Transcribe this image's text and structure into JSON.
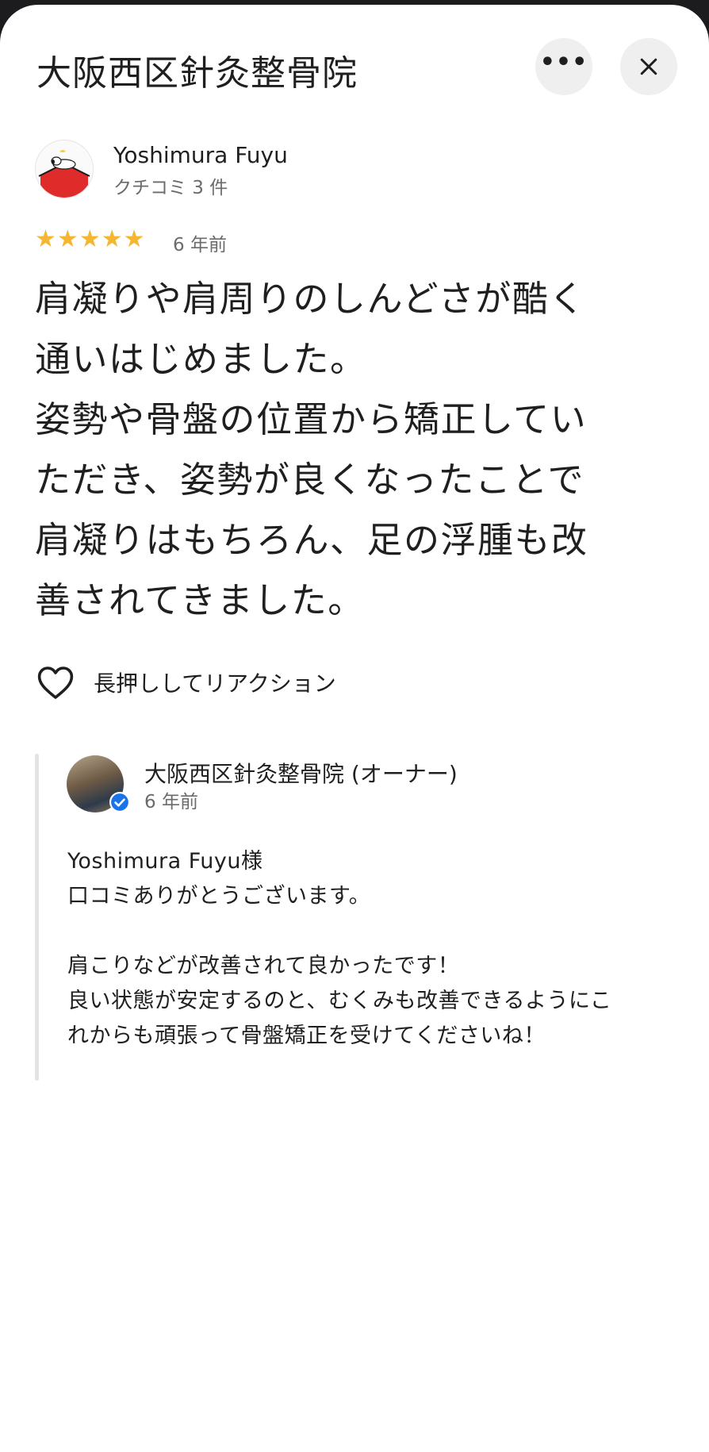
{
  "header": {
    "title": "大阪西区針灸整骨院",
    "more_icon": "more-horizontal-icon",
    "close_icon": "close-icon"
  },
  "review": {
    "reviewer_name": "Yoshimura Fuyu",
    "reviewer_count": "クチコミ 3 件",
    "rating": 5,
    "rating_max": 5,
    "date": "6 年前",
    "text_lines": [
      "肩凝りや肩周りのしんどさが酷く",
      "通いはじめました。",
      "姿勢や骨盤の位置から矯正してい",
      "ただき、姿勢が良くなったことで",
      "肩凝りはもちろん、足の浮腫も改",
      "善されてきました。"
    ],
    "reaction_label": "長押ししてリアクション"
  },
  "owner_reply": {
    "name": "大阪西区針灸整骨院 (オーナー)",
    "date": "6 年前",
    "text_lines": [
      "Yoshimura Fuyu様",
      "口コミありがとうございます。",
      "",
      "肩こりなどが改善されて良かったです！",
      "良い状態が安定するのと、むくみも改善できるようにこ",
      "れからも頑張って骨盤矯正を受けてくださいね！"
    ]
  },
  "colors": {
    "star": "#f5b630",
    "verified": "#1a73e8",
    "secondary_text": "#6b6b6b"
  }
}
